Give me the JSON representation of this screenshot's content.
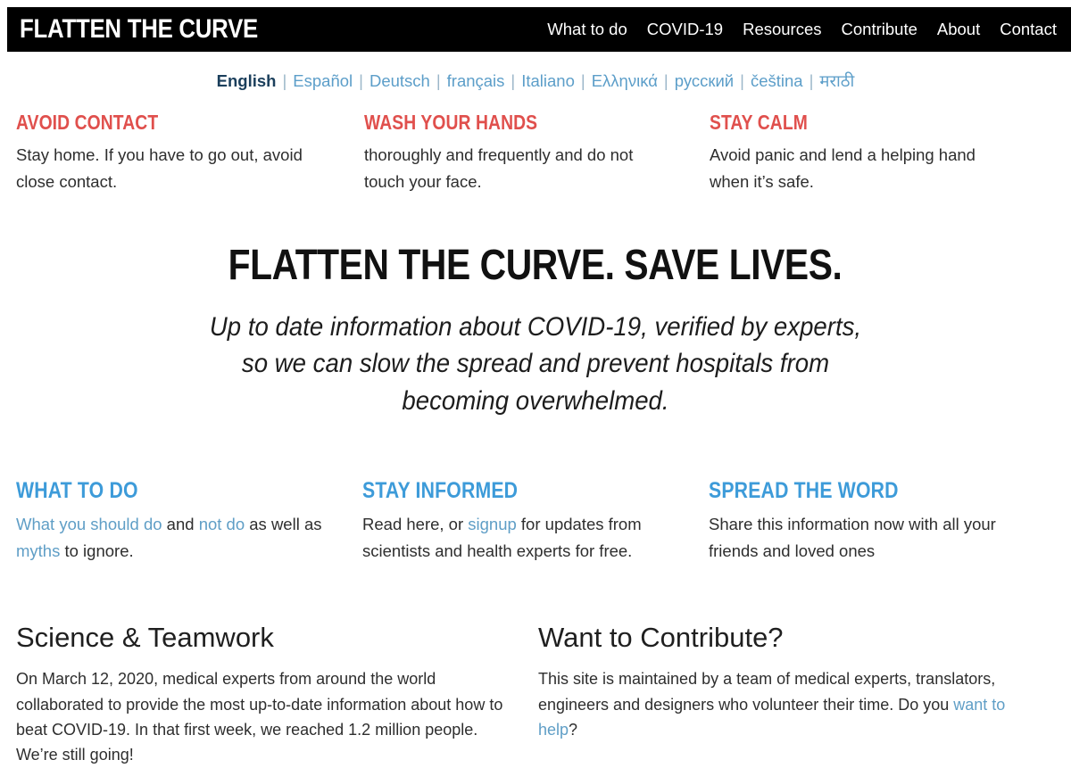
{
  "header": {
    "brand": "FLATTEN THE CURVE",
    "nav": [
      {
        "label": "What to do"
      },
      {
        "label": "COVID-19"
      },
      {
        "label": "Resources"
      },
      {
        "label": "Contribute"
      },
      {
        "label": "About"
      },
      {
        "label": "Contact"
      }
    ],
    "bar_color": "#000000",
    "text_color": "#ffffff"
  },
  "languages": {
    "separator": "|",
    "active_color": "#1b3f5c",
    "link_color": "#5c9ec9",
    "items": [
      {
        "label": "English",
        "active": true
      },
      {
        "label": "Español",
        "active": false
      },
      {
        "label": "Deutsch",
        "active": false
      },
      {
        "label": "français",
        "active": false
      },
      {
        "label": "Italiano",
        "active": false
      },
      {
        "label": "Ελληνικά",
        "active": false
      },
      {
        "label": "русский",
        "active": false
      },
      {
        "label": "čeština",
        "active": false
      },
      {
        "label": "मराठी",
        "active": false
      }
    ]
  },
  "tips": {
    "heading_color": "#e0504d",
    "items": [
      {
        "heading": "AVOID CONTACT",
        "body": "Stay home. If you have to go out, avoid close contact."
      },
      {
        "heading": "WASH YOUR HANDS",
        "body": "thoroughly and frequently and do not touch your face."
      },
      {
        "heading": "STAY CALM",
        "body": "Avoid panic and lend a helping hand when it’s safe."
      }
    ]
  },
  "hero": {
    "title": "FLATTEN THE CURVE. SAVE LIVES.",
    "subtitle": "Up to date information about COVID-19, verified by experts, so we can slow the spread and prevent hospitals from becoming overwhelmed."
  },
  "actions": {
    "heading_color": "#3d9bd9",
    "link_color": "#5f9ec6",
    "items": [
      {
        "heading": "WHAT TO DO",
        "parts": [
          {
            "text": "What you should do",
            "link": true
          },
          {
            "text": " and ",
            "link": false
          },
          {
            "text": "not do",
            "link": true
          },
          {
            "text": " as well as ",
            "link": false
          },
          {
            "text": "myths",
            "link": true
          },
          {
            "text": " to ignore.",
            "link": false
          }
        ]
      },
      {
        "heading": "STAY INFORMED",
        "parts": [
          {
            "text": "Read here, or ",
            "link": false
          },
          {
            "text": "signup",
            "link": true
          },
          {
            "text": " for updates from scientists and health experts for free.",
            "link": false
          }
        ]
      },
      {
        "heading": "SPREAD THE WORD",
        "parts": [
          {
            "text": "Share this information now with all your friends and loved ones",
            "link": false
          }
        ]
      }
    ]
  },
  "bottom": {
    "left": {
      "title": "Science & Teamwork",
      "body": "On March 12, 2020, medical experts from around the world collaborated to provide the most up-to-date information about how to beat COVID-19. In that first week, we reached 1.2 million people. We’re still going!"
    },
    "right": {
      "title": "Want to Contribute?",
      "parts": [
        {
          "text": "This site is maintained by a team of medical experts, translators, engineers and designers who volunteer their time. Do you ",
          "link": false
        },
        {
          "text": "want to help",
          "link": true
        },
        {
          "text": "?",
          "link": false
        }
      ]
    }
  }
}
